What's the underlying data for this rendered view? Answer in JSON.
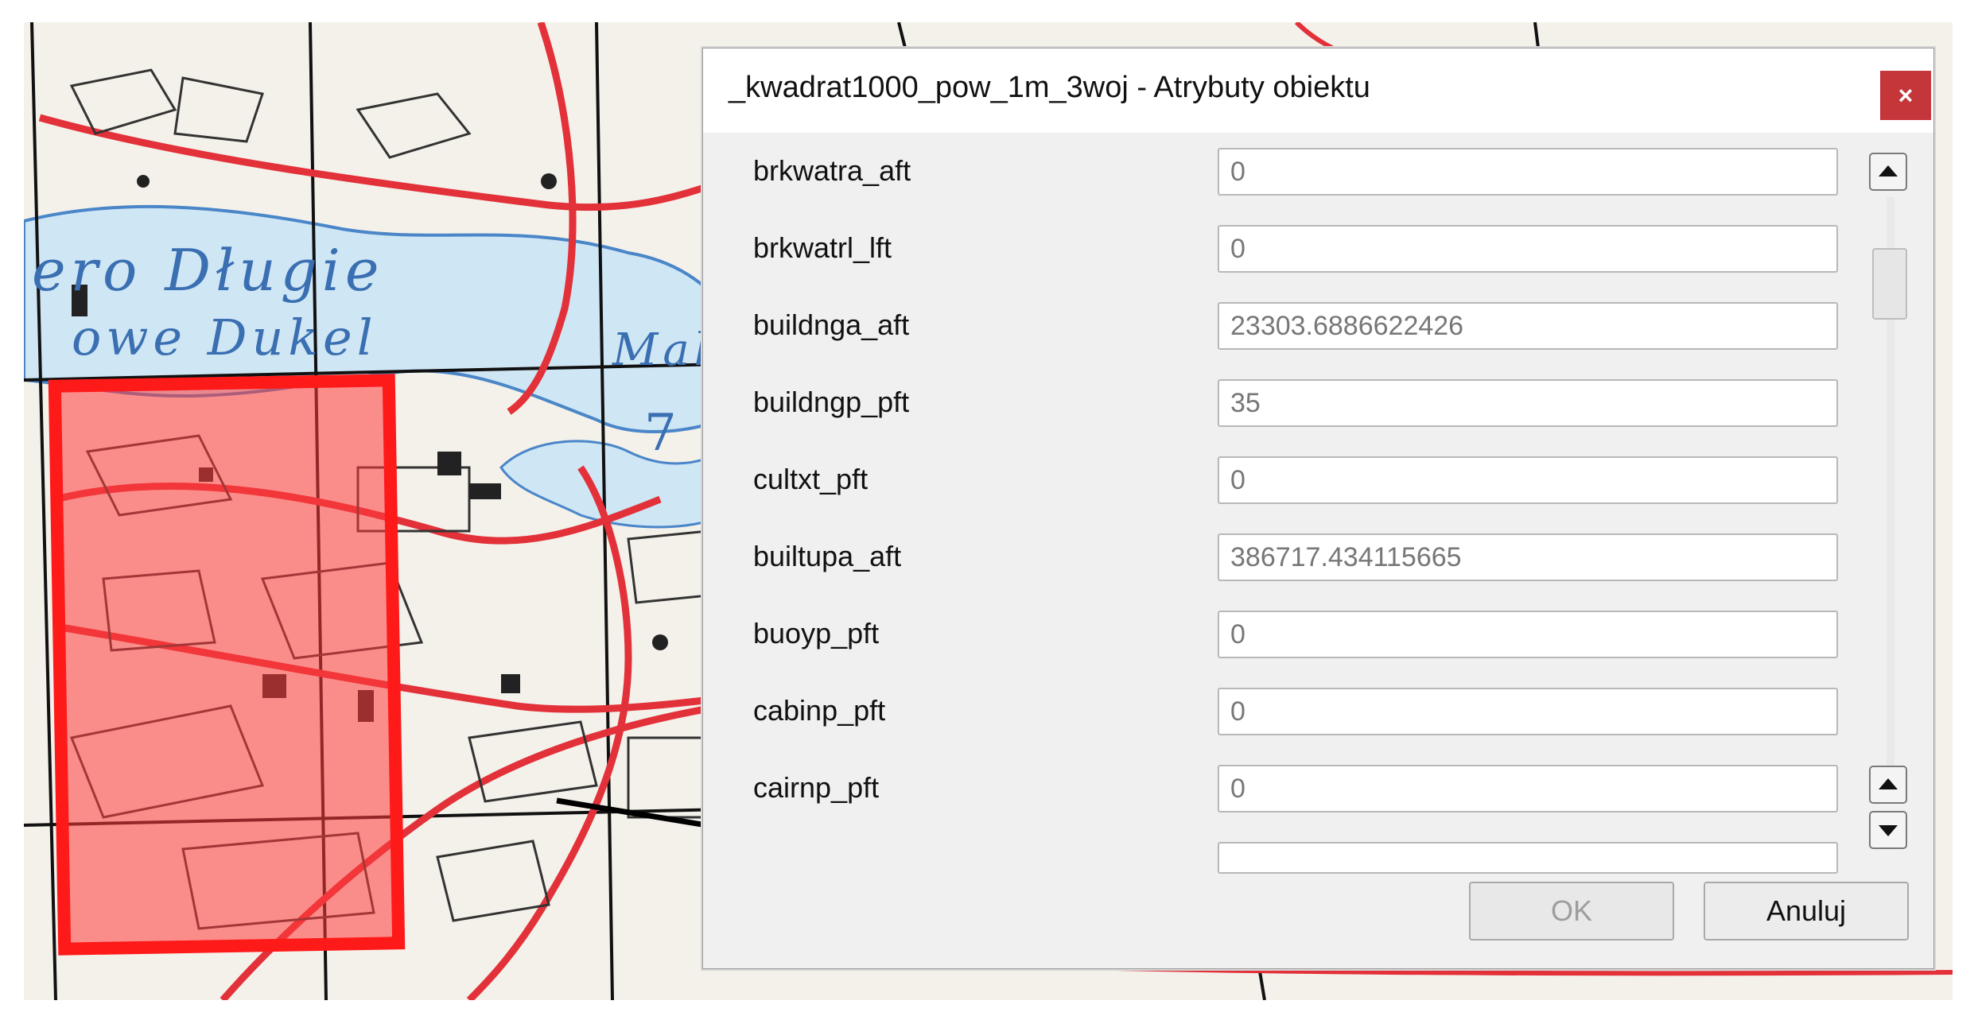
{
  "dialog": {
    "title": "_kwadrat1000_pow_1m_3woj - Atrybuty obiektu",
    "close_label": "×",
    "ok_label": "OK",
    "cancel_label": "Anuluj"
  },
  "fields": [
    {
      "label": "brkwatra_aft",
      "value": "0"
    },
    {
      "label": "brkwatrl_lft",
      "value": "0"
    },
    {
      "label": "buildnga_aft",
      "value": "23303.6886622426"
    },
    {
      "label": "buildngp_pft",
      "value": "35"
    },
    {
      "label": "cultxt_pft",
      "value": "0"
    },
    {
      "label": "builtupa_aft",
      "value": "386717.434115665"
    },
    {
      "label": "buoyp_pft",
      "value": "0"
    },
    {
      "label": "cabinp_pft",
      "value": "0"
    },
    {
      "label": "cairnp_pft",
      "value": "0"
    }
  ],
  "map": {
    "labels": [
      "ero Długie",
      "owe Dukel",
      "Male",
      "7"
    ],
    "highlight_color": "#ff2a2a",
    "water_color": "#cfe6f5"
  },
  "icons": {
    "scroll_up": "triangle-up-icon",
    "scroll_down": "triangle-down-icon",
    "close": "close-icon"
  }
}
